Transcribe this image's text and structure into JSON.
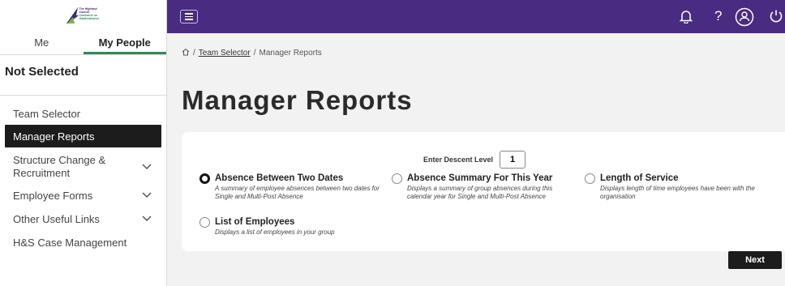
{
  "brand": {
    "logo_lines": [
      "The Highland",
      "Council",
      "Comhairle na",
      "Gàidhealtachd"
    ]
  },
  "sidebar": {
    "tabs": [
      {
        "label": "Me",
        "active": false
      },
      {
        "label": "My People",
        "active": true
      }
    ],
    "selection_status": "Not Selected",
    "items": [
      {
        "label": "Team Selector",
        "active": false,
        "expandable": false
      },
      {
        "label": "Manager Reports",
        "active": true,
        "expandable": false
      },
      {
        "label": "Structure Change & Recruitment",
        "active": false,
        "expandable": true
      },
      {
        "label": "Employee Forms",
        "active": false,
        "expandable": true
      },
      {
        "label": "Other Useful Links",
        "active": false,
        "expandable": true
      },
      {
        "label": "H&S Case Management",
        "active": false,
        "expandable": false
      }
    ]
  },
  "topbar": {
    "color": "#4a2b82",
    "icons": [
      "menu-icon",
      "bell-icon",
      "help-icon",
      "user-icon",
      "power-icon"
    ],
    "help_glyph": "?"
  },
  "breadcrumb": {
    "separator": "/",
    "items": [
      "Team Selector",
      "Manager Reports"
    ]
  },
  "page": {
    "title": "Manager Reports"
  },
  "report_form": {
    "descent_label": "Enter Descent Level",
    "descent_value": "1",
    "options": [
      {
        "title": "Absence Between Two Dates",
        "description": "A summary of employee absences between two dates for Single and Multi-Post Absence",
        "selected": true
      },
      {
        "title": "Absence Summary For This Year",
        "description": "Displays a summary of group absences during this calendar year for Single and Multi-Post Absence",
        "selected": false
      },
      {
        "title": "Length of Service",
        "description": "Displays length of time employees have been with the organisation",
        "selected": false
      },
      {
        "title": "List of Employees",
        "description": "Displays a list of employees in your group",
        "selected": false
      }
    ],
    "next_label": "Next"
  }
}
